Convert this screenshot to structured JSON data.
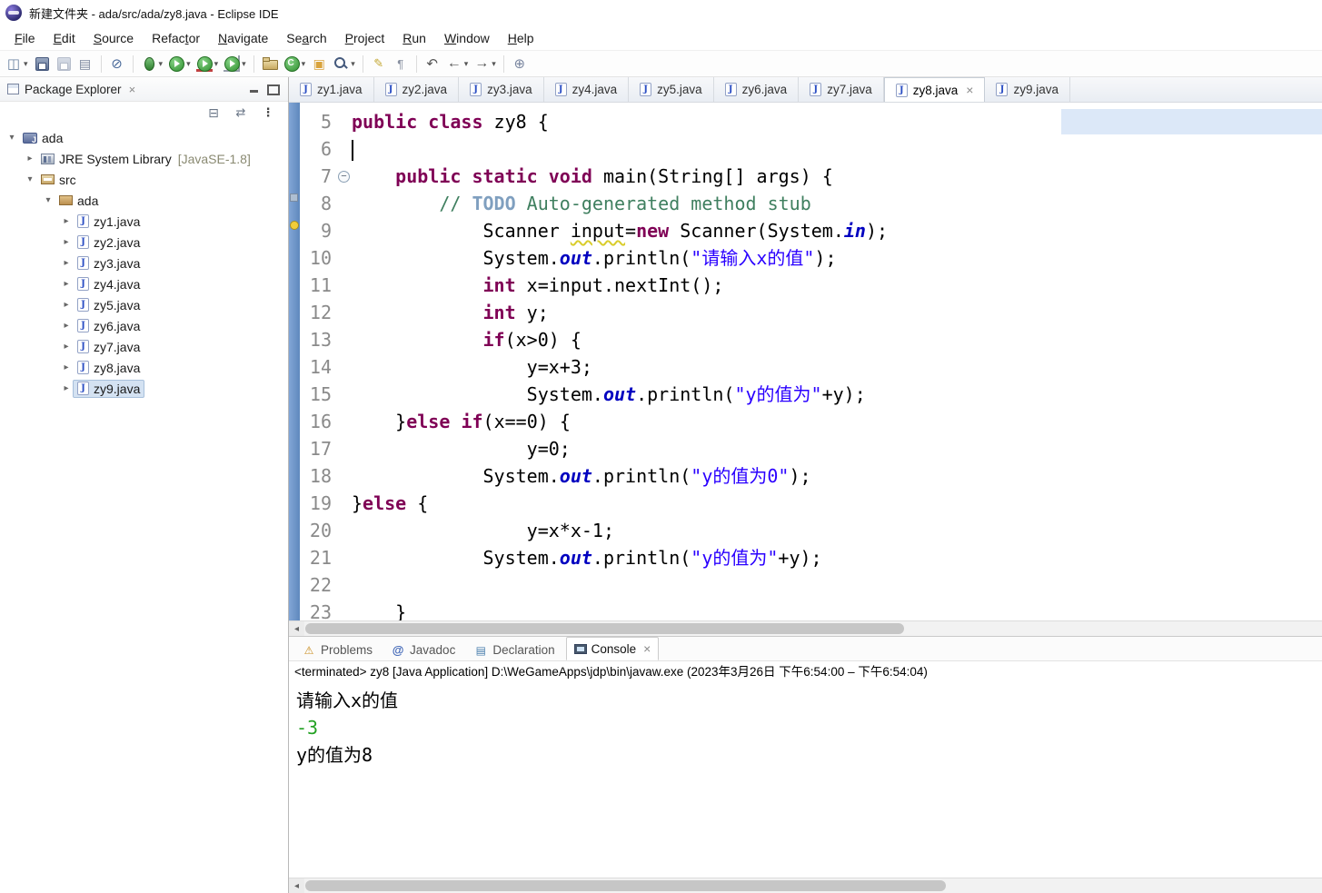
{
  "window": {
    "title": "新建文件夹 - ada/src/ada/zy8.java - Eclipse IDE",
    "app_icon": "eclipse-logo"
  },
  "menubar": [
    {
      "label": "File",
      "m": 0
    },
    {
      "label": "Edit",
      "m": 0
    },
    {
      "label": "Source",
      "m": 0
    },
    {
      "label": "Refactor",
      "m": 5
    },
    {
      "label": "Navigate",
      "m": 0
    },
    {
      "label": "Search",
      "m": 2
    },
    {
      "label": "Project",
      "m": 0
    },
    {
      "label": "Run",
      "m": 0
    },
    {
      "label": "Window",
      "m": 0
    },
    {
      "label": "Help",
      "m": 0
    }
  ],
  "toolbar": [
    {
      "name": "new-wizard",
      "type": "new",
      "caret": true
    },
    {
      "name": "save",
      "type": "save"
    },
    {
      "name": "save-all",
      "type": "saveall",
      "disabled": true
    },
    {
      "name": "print",
      "type": "print"
    },
    {
      "sep": true
    },
    {
      "name": "skip-all-breakpoints",
      "type": "skip"
    },
    {
      "sep": true
    },
    {
      "name": "debug",
      "type": "debug",
      "caret": true
    },
    {
      "name": "run",
      "type": "run",
      "caret": true
    },
    {
      "name": "coverage",
      "type": "coverage",
      "caret": true
    },
    {
      "name": "run-external-tools",
      "type": "ext",
      "caret": true
    },
    {
      "sep": true
    },
    {
      "name": "new-java-project",
      "type": "project"
    },
    {
      "name": "new-java-class",
      "type": "class",
      "caret": true
    },
    {
      "name": "open-task",
      "type": "task"
    },
    {
      "name": "search",
      "type": "search",
      "caret": true
    },
    {
      "sep": true
    },
    {
      "name": "toggle-mark-occurrences",
      "type": "mark"
    },
    {
      "name": "show-whitespace",
      "type": "ws"
    },
    {
      "sep": true
    },
    {
      "name": "last-edit-location",
      "type": "lastedit"
    },
    {
      "name": "back",
      "type": "back",
      "caret": true
    },
    {
      "name": "forward",
      "type": "forward",
      "caret": true
    },
    {
      "sep": true
    },
    {
      "name": "pin-editor",
      "type": "pin"
    }
  ],
  "package_explorer": {
    "title": "Package Explorer",
    "view_controls": [
      "minimize",
      "maximize"
    ],
    "toolbar_icons": [
      "collapse-all",
      "link-with-editor",
      "view-menu"
    ],
    "tree": [
      {
        "label": "ada",
        "icon": "project",
        "indent": 0,
        "state": "expanded"
      },
      {
        "label": "JRE System Library",
        "suffix": " [JavaSE-1.8]",
        "icon": "library",
        "indent": 1,
        "state": "collapsed"
      },
      {
        "label": "src",
        "icon": "src",
        "indent": 1,
        "state": "expanded"
      },
      {
        "label": "ada",
        "icon": "package",
        "indent": 2,
        "state": "expanded"
      },
      {
        "label": "zy1.java",
        "icon": "java",
        "indent": 3,
        "state": "collapsed"
      },
      {
        "label": "zy2.java",
        "icon": "java",
        "indent": 3,
        "state": "collapsed"
      },
      {
        "label": "zy3.java",
        "icon": "java",
        "indent": 3,
        "state": "collapsed"
      },
      {
        "label": "zy4.java",
        "icon": "java",
        "indent": 3,
        "state": "collapsed"
      },
      {
        "label": "zy5.java",
        "icon": "java",
        "indent": 3,
        "state": "collapsed"
      },
      {
        "label": "zy6.java",
        "icon": "java",
        "indent": 3,
        "state": "collapsed"
      },
      {
        "label": "zy7.java",
        "icon": "java",
        "indent": 3,
        "state": "collapsed"
      },
      {
        "label": "zy8.java",
        "icon": "java",
        "indent": 3,
        "state": "collapsed"
      },
      {
        "label": "zy9.java",
        "icon": "java",
        "indent": 3,
        "state": "collapsed",
        "selected": true
      }
    ]
  },
  "editor": {
    "tabs": [
      {
        "label": "zy1.java"
      },
      {
        "label": "zy2.java"
      },
      {
        "label": "zy3.java"
      },
      {
        "label": "zy4.java"
      },
      {
        "label": "zy5.java"
      },
      {
        "label": "zy6.java"
      },
      {
        "label": "zy7.java"
      },
      {
        "label": "zy8.java",
        "active": true
      },
      {
        "label": "zy9.java"
      }
    ],
    "lines": [
      {
        "n": 5,
        "indent": 0,
        "segs": [
          [
            "k",
            "public"
          ],
          [
            "d",
            " "
          ],
          [
            "k",
            "class"
          ],
          [
            "d",
            " zy8 {"
          ]
        ]
      },
      {
        "n": 6,
        "indent": 0,
        "cursor": true,
        "segs": []
      },
      {
        "n": 7,
        "indent": 1,
        "fold": true,
        "segs": [
          [
            "k",
            "public"
          ],
          [
            "d",
            " "
          ],
          [
            "k",
            "static"
          ],
          [
            "d",
            " "
          ],
          [
            "k",
            "void"
          ],
          [
            "d",
            " main(String[] args) {"
          ]
        ]
      },
      {
        "n": 8,
        "indent": 2,
        "segs": [
          [
            "c",
            "// "
          ],
          [
            "t",
            "TODO"
          ],
          [
            "c",
            " Auto-generated method stub"
          ]
        ]
      },
      {
        "n": 9,
        "indent": 3,
        "segs": [
          [
            "d",
            "Scanner "
          ],
          [
            "w",
            "input"
          ],
          [
            "d",
            "="
          ],
          [
            "k",
            "new"
          ],
          [
            "d",
            " Scanner(System."
          ],
          [
            "f",
            "in"
          ],
          [
            "d",
            ");"
          ]
        ]
      },
      {
        "n": 10,
        "indent": 3,
        "segs": [
          [
            "d",
            "System."
          ],
          [
            "f",
            "out"
          ],
          [
            "d",
            ".println("
          ],
          [
            "s",
            "\"请输入x的值\""
          ],
          [
            "d",
            ");"
          ]
        ]
      },
      {
        "n": 11,
        "indent": 3,
        "segs": [
          [
            "k",
            "int"
          ],
          [
            "d",
            " x=input.nextInt();"
          ]
        ]
      },
      {
        "n": 12,
        "indent": 3,
        "segs": [
          [
            "k",
            "int"
          ],
          [
            "d",
            " y;"
          ]
        ]
      },
      {
        "n": 13,
        "indent": 3,
        "segs": [
          [
            "k",
            "if"
          ],
          [
            "d",
            "(x>0) {"
          ]
        ]
      },
      {
        "n": 14,
        "indent": 4,
        "segs": [
          [
            "d",
            "y=x+3;"
          ]
        ]
      },
      {
        "n": 15,
        "indent": 4,
        "segs": [
          [
            "d",
            "System."
          ],
          [
            "f",
            "out"
          ],
          [
            "d",
            ".println("
          ],
          [
            "s",
            "\"y的值为\""
          ],
          [
            "d",
            "+y);"
          ]
        ]
      },
      {
        "n": 16,
        "indent": 1,
        "segs": [
          [
            "d",
            "}"
          ],
          [
            "k",
            "else"
          ],
          [
            "d",
            " "
          ],
          [
            "k",
            "if"
          ],
          [
            "d",
            "(x==0) {"
          ]
        ]
      },
      {
        "n": 17,
        "indent": 4,
        "segs": [
          [
            "d",
            "y=0;"
          ]
        ]
      },
      {
        "n": 18,
        "indent": 3,
        "segs": [
          [
            "d",
            "System."
          ],
          [
            "f",
            "out"
          ],
          [
            "d",
            ".println("
          ],
          [
            "s",
            "\"y的值为0\""
          ],
          [
            "d",
            ");"
          ]
        ]
      },
      {
        "n": 19,
        "indent": 0,
        "segs": [
          [
            "d",
            "}"
          ],
          [
            "k",
            "else"
          ],
          [
            "d",
            " {"
          ]
        ]
      },
      {
        "n": 20,
        "indent": 4,
        "segs": [
          [
            "d",
            "y=x*x-1;"
          ]
        ]
      },
      {
        "n": 21,
        "indent": 3,
        "segs": [
          [
            "d",
            "System."
          ],
          [
            "f",
            "out"
          ],
          [
            "d",
            ".println("
          ],
          [
            "s",
            "\"y的值为\""
          ],
          [
            "d",
            "+y);"
          ]
        ]
      },
      {
        "n": 22,
        "indent": 0,
        "segs": []
      },
      {
        "n": 23,
        "indent": 1,
        "segs": [
          [
            "d",
            "}"
          ]
        ]
      }
    ]
  },
  "console": {
    "tabs": [
      {
        "label": "Problems",
        "icon": "problems"
      },
      {
        "label": "Javadoc",
        "icon": "javadoc"
      },
      {
        "label": "Declaration",
        "icon": "declaration"
      },
      {
        "label": "Console",
        "icon": "console",
        "active": true
      }
    ],
    "status": "<terminated> zy8 [Java Application] D:\\WeGameApps\\jdp\\bin\\javaw.exe (2023年3月26日 下午6:54:00 – 下午6:54:04)",
    "output": [
      {
        "text": "请输入x的值",
        "kind": "stdout"
      },
      {
        "text": "-3",
        "kind": "input"
      },
      {
        "text": "y的值为8",
        "kind": "stdout"
      }
    ]
  },
  "colors": {
    "keyword": "#7f0055",
    "string": "#2a00ff",
    "comment": "#3f7f5f",
    "task_tag": "#7f9fbf",
    "static_field": "#0000c0",
    "console_input": "#23a123",
    "ruler_blue": "#6f97cc",
    "line_highlight": "#dce8f8",
    "selection_bg": "#d4e2f2"
  }
}
